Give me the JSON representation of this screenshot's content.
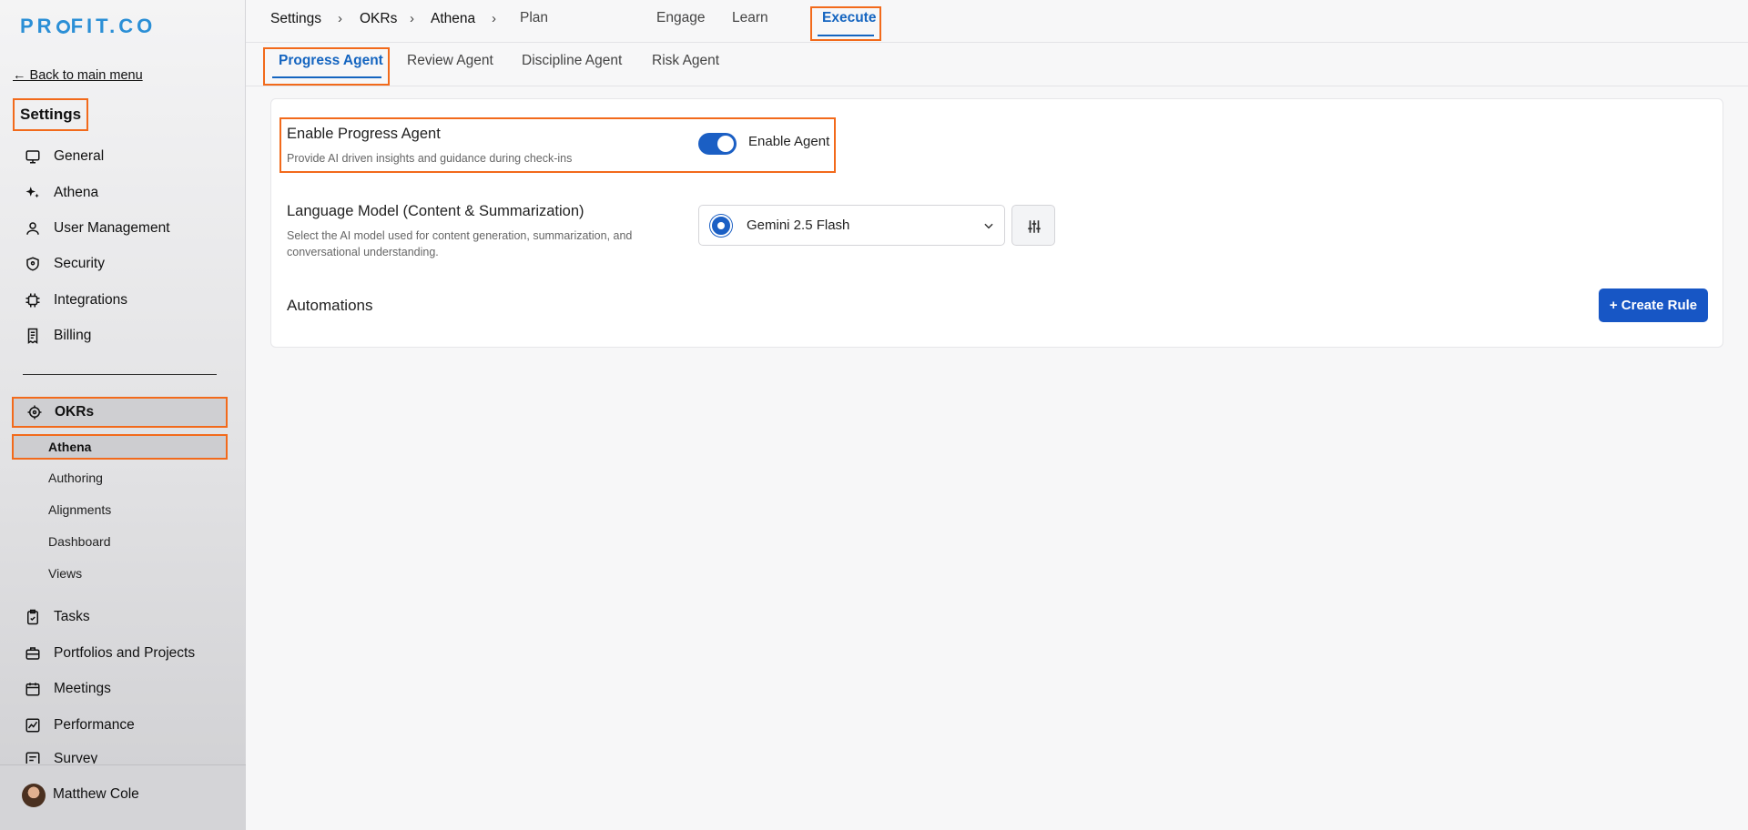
{
  "brand": {
    "name": "PROFIT.CO"
  },
  "sidebar": {
    "back_label": "← Back to main menu",
    "title": "Settings",
    "items": [
      {
        "label": "General",
        "icon": "monitor-icon"
      },
      {
        "label": "Athena",
        "icon": "sparkle-icon"
      },
      {
        "label": "User Management",
        "icon": "user-icon"
      },
      {
        "label": "Security",
        "icon": "shield-icon"
      },
      {
        "label": "Integrations",
        "icon": "chip-icon"
      },
      {
        "label": "Billing",
        "icon": "receipt-icon"
      }
    ],
    "okrs": {
      "label": "OKRs",
      "icon": "target-icon"
    },
    "okr_sub": [
      "Athena",
      "Authoring",
      "Alignments",
      "Dashboard",
      "Views"
    ],
    "lower_items": [
      {
        "label": "Tasks",
        "icon": "clipboard-check-icon"
      },
      {
        "label": "Portfolios and Projects",
        "icon": "briefcase-icon"
      },
      {
        "label": "Meetings",
        "icon": "calendar-icon"
      },
      {
        "label": "Performance",
        "icon": "chart-line-icon"
      },
      {
        "label": "Survey",
        "icon": "list-icon"
      }
    ],
    "user": {
      "name": "Matthew Cole"
    }
  },
  "topbar": {
    "breadcrumb": [
      "Settings",
      "OKRs",
      "Athena"
    ],
    "separator": "›",
    "tabs": [
      "Plan",
      "Execute",
      "Engage",
      "Learn"
    ],
    "active_tab": "Execute"
  },
  "subtabs": {
    "items": [
      "Progress Agent",
      "Review Agent",
      "Discipline Agent",
      "Risk Agent"
    ],
    "active": "Progress Agent"
  },
  "card": {
    "enable_title": "Enable Progress Agent",
    "enable_desc": "Provide AI driven insights and guidance during check-ins",
    "toggle_label": "Enable Agent",
    "toggle_on": true,
    "model_title": "Language Model (Content & Summarization)",
    "model_desc_1": "Select the AI model used for content generation, summarization, and",
    "model_desc_2": "conversational understanding.",
    "model_value": "Gemini 2.5 Flash",
    "automations_title": "Automations",
    "create_rule_label": "+ Create Rule"
  },
  "colors": {
    "accent": "#1565c0",
    "highlight": "#f26a1b",
    "button": "#1756c5"
  }
}
